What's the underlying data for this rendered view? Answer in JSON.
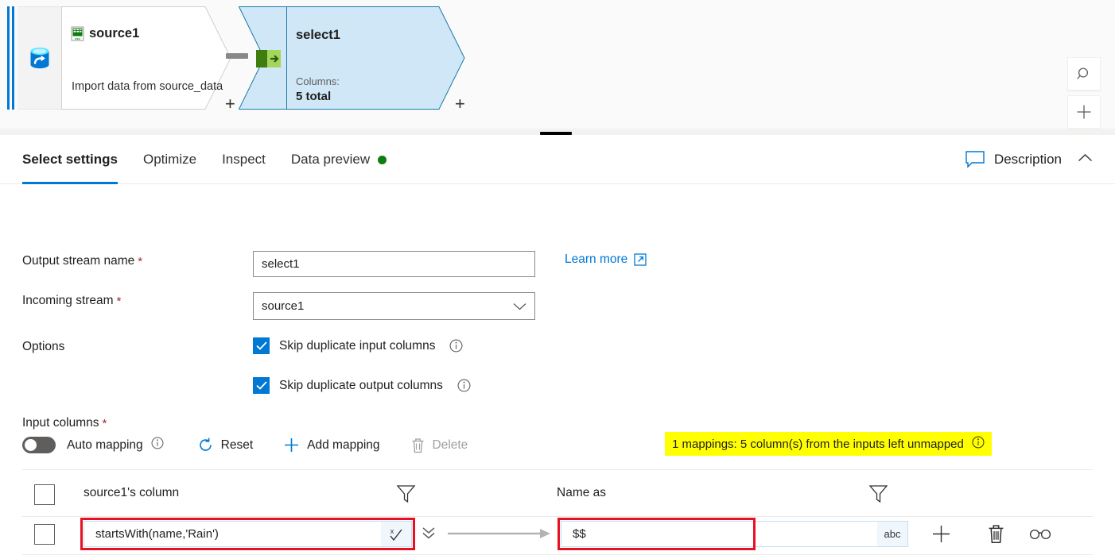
{
  "canvas": {
    "source_node": {
      "title": "source1",
      "subtitle": "Import data from source_data",
      "plus_label": "+",
      "file_icon": "csv-file-icon",
      "service_icon": "azure-data-factory-icon"
    },
    "select_node": {
      "title": "select1",
      "columns_label": "Columns:",
      "columns_value": "5 total",
      "plus_label": "+",
      "transform_icon": "select-transform-icon"
    },
    "tools": {
      "search_icon": "search-icon",
      "add_icon": "plus-icon"
    }
  },
  "panel": {
    "tabs": [
      {
        "label": "Select settings",
        "active": true,
        "dot": false
      },
      {
        "label": "Optimize",
        "active": false,
        "dot": false
      },
      {
        "label": "Inspect",
        "active": false,
        "dot": false
      },
      {
        "label": "Data preview",
        "active": false,
        "dot": true
      }
    ],
    "description": {
      "label": "Description",
      "icon": "comment-icon",
      "collapse_icon": "chevron-up-icon"
    },
    "form": {
      "output_stream": {
        "label": "Output stream name",
        "required": "*",
        "value": "select1",
        "placeholder": "Output stream name"
      },
      "incoming_stream": {
        "label": "Incoming stream",
        "required": "*",
        "value": "source1",
        "chevron_icon": "chevron-down-icon"
      },
      "learn_more": {
        "label": "Learn more",
        "icon": "external-link-icon"
      },
      "options": {
        "label": "Options",
        "items": [
          {
            "label": "Skip duplicate input columns",
            "checked": true,
            "info_icon": "info-icon"
          },
          {
            "label": "Skip duplicate output columns",
            "checked": true,
            "info_icon": "info-icon"
          }
        ]
      }
    },
    "input_columns": {
      "label": "Input columns",
      "required": "*",
      "auto_mapping": {
        "label": "Auto mapping",
        "on": false,
        "info_icon": "info-icon"
      },
      "reset": {
        "label": "Reset",
        "icon": "refresh-icon"
      },
      "add_mapping": {
        "label": "Add mapping",
        "icon": "plus-icon"
      },
      "delete": {
        "label": "Delete",
        "icon": "trash-icon",
        "disabled": true
      },
      "banner": {
        "text": "1 mappings: 5 column(s) from the inputs left unmapped",
        "info_icon": "info-icon",
        "background": "#ffff00"
      }
    },
    "mapping_table": {
      "headers": [
        {
          "label": "source1's column",
          "filter_icon": "filter-icon"
        },
        {
          "label": "Name as",
          "filter_icon": "filter-icon"
        }
      ],
      "select_all_checkbox": false,
      "rows": [
        {
          "selected": false,
          "source_expression": "startsWith(name,'Rain')",
          "source_expression_icon": "expression-builder-icon",
          "expand_icon": "double-chevron-down-icon",
          "map_arrow_icon": "arrow-right-icon",
          "name_as": "$$",
          "name_as_type_icon": "abc",
          "actions": [
            {
              "icon": "plus-icon",
              "name": "add-row-button"
            },
            {
              "icon": "trash-icon",
              "name": "delete-row-button"
            },
            {
              "icon": "glasses-icon",
              "name": "preview-button"
            }
          ]
        }
      ]
    }
  },
  "colors": {
    "accent": "#0078d4",
    "select_node_fill": "#cfe7f7",
    "select_node_border": "#1a7aa8",
    "warning_bg": "#ffff00",
    "highlight_border": "#e81123",
    "status_dot": "#107c10"
  }
}
